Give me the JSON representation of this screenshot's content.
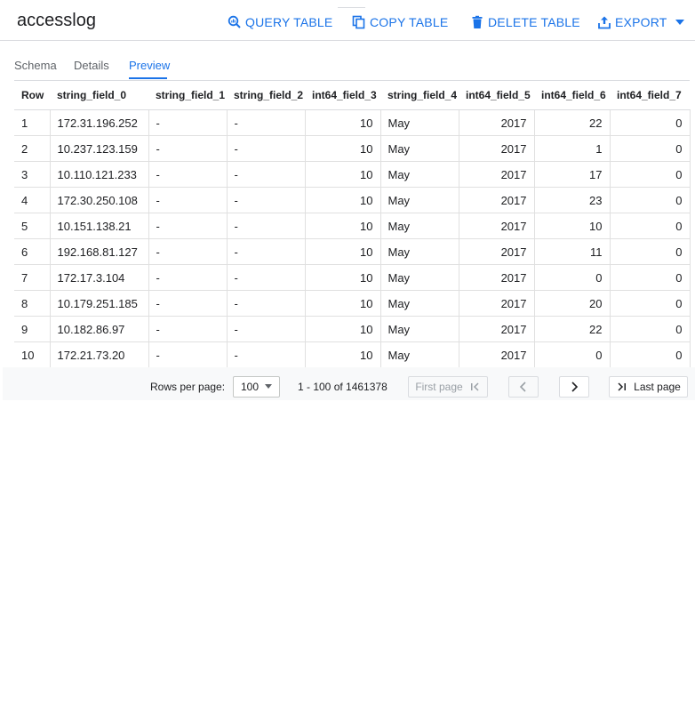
{
  "header": {
    "title": "accesslog",
    "query_label": "QUERY TABLE",
    "copy_label": "COPY TABLE",
    "delete_label": "DELETE TABLE",
    "export_label": "EXPORT",
    "accent_color": "#1a73e8"
  },
  "tabs": [
    {
      "label": "Schema",
      "active": false
    },
    {
      "label": "Details",
      "active": false
    },
    {
      "label": "Preview",
      "active": true
    }
  ],
  "table": {
    "columns": [
      "Row",
      "string_field_0",
      "string_field_1",
      "string_field_2",
      "int64_field_3",
      "string_field_4",
      "int64_field_5",
      "int64_field_6",
      "int64_field_7"
    ],
    "rows": [
      [
        "1",
        "172.31.196.252",
        "-",
        "-",
        "10",
        "May",
        "2017",
        "22",
        "0"
      ],
      [
        "2",
        "10.237.123.159",
        "-",
        "-",
        "10",
        "May",
        "2017",
        "1",
        "0"
      ],
      [
        "3",
        "10.110.121.233",
        "-",
        "-",
        "10",
        "May",
        "2017",
        "17",
        "0"
      ],
      [
        "4",
        "172.30.250.108",
        "-",
        "-",
        "10",
        "May",
        "2017",
        "23",
        "0"
      ],
      [
        "5",
        "10.151.138.21",
        "-",
        "-",
        "10",
        "May",
        "2017",
        "10",
        "0"
      ],
      [
        "6",
        "192.168.81.127",
        "-",
        "-",
        "10",
        "May",
        "2017",
        "11",
        "0"
      ],
      [
        "7",
        "172.17.3.104",
        "-",
        "-",
        "10",
        "May",
        "2017",
        "0",
        "0"
      ],
      [
        "8",
        "10.179.251.185",
        "-",
        "-",
        "10",
        "May",
        "2017",
        "20",
        "0"
      ],
      [
        "9",
        "10.182.86.97",
        "-",
        "-",
        "10",
        "May",
        "2017",
        "22",
        "0"
      ],
      [
        "10",
        "172.21.73.20",
        "-",
        "-",
        "10",
        "May",
        "2017",
        "0",
        "0"
      ]
    ]
  },
  "pagination": {
    "rows_per_page_label": "Rows per page:",
    "rows_per_page_value": "100",
    "range_text": "1 - 100 of 1461378",
    "first_label": "First page",
    "last_label": "Last page"
  }
}
